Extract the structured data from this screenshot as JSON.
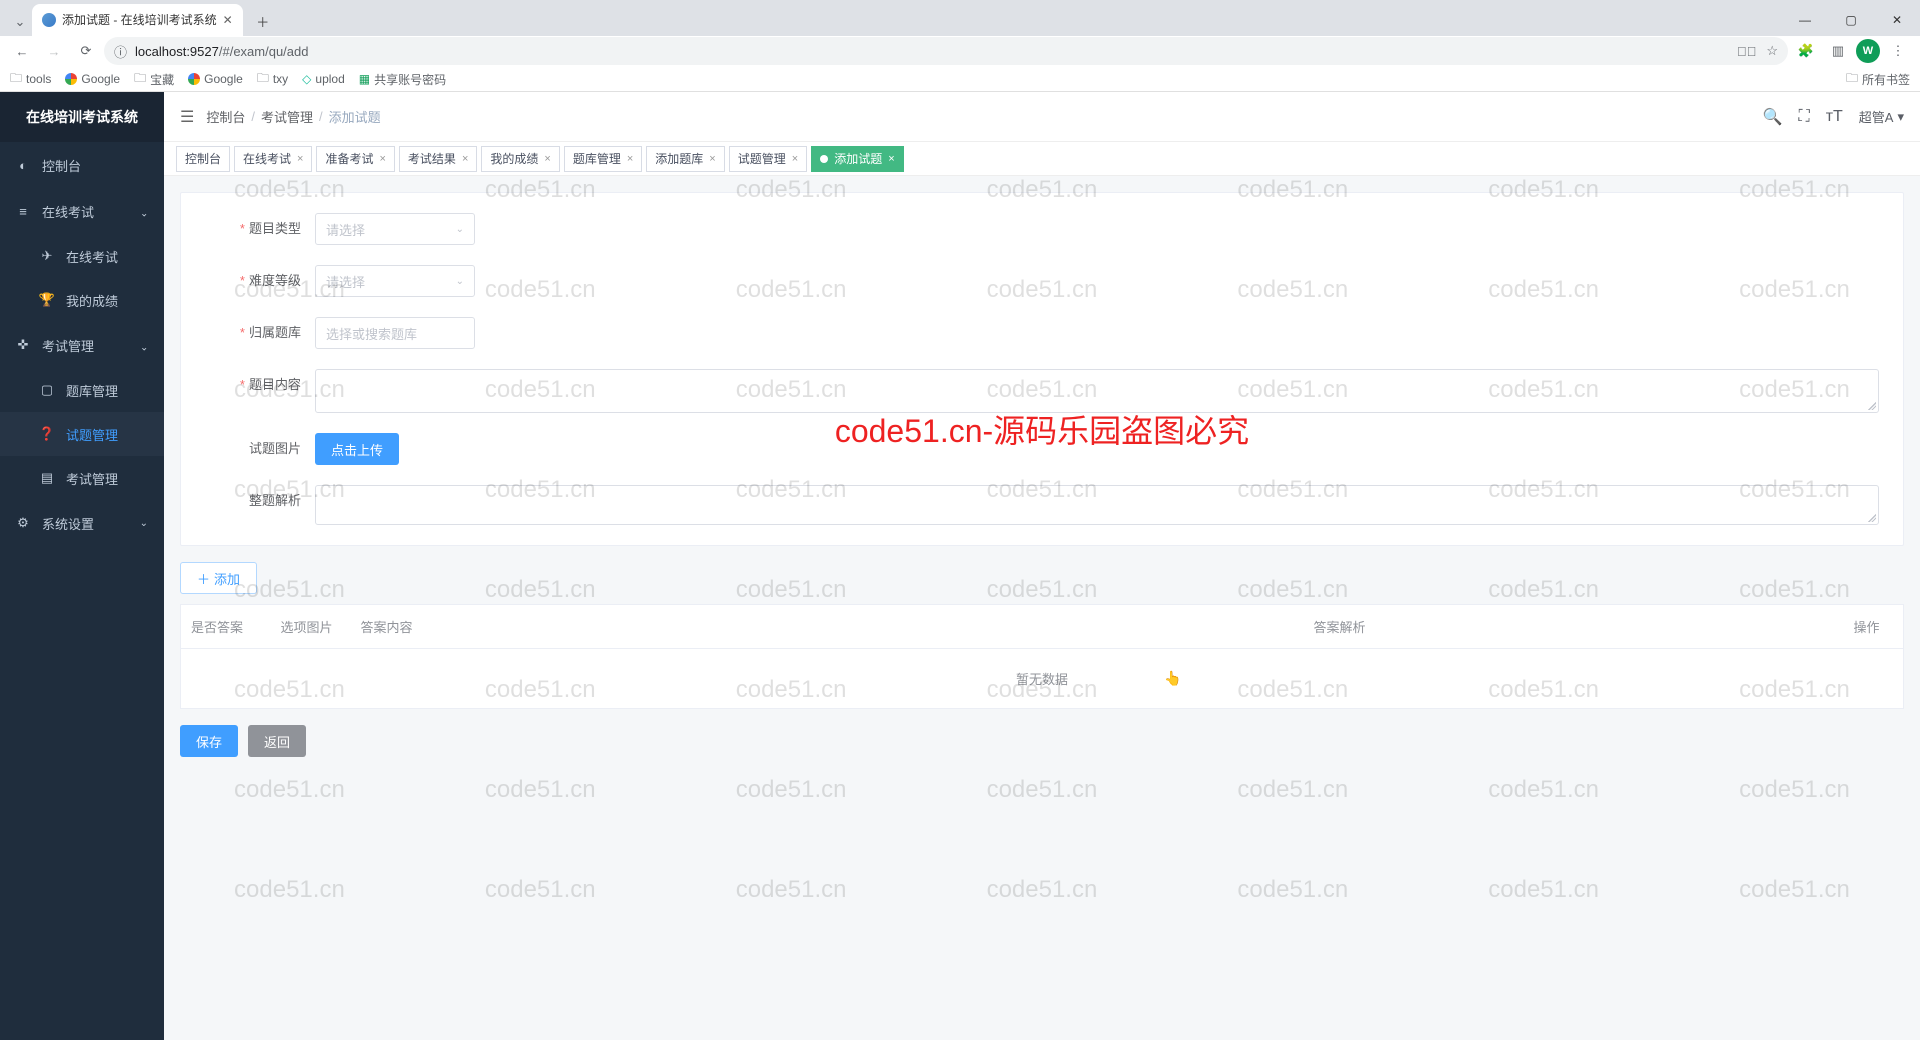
{
  "browser": {
    "tab_title": "添加试题 - 在线培训考试系统",
    "url_host": "localhost:9527",
    "url_path": "/#/exam/qu/add",
    "avatar_letter": "W",
    "bookmarks": [
      "tools",
      "Google",
      "宝藏",
      "Google",
      "txy",
      "uplod",
      "共享账号密码"
    ],
    "all_bookmarks": "所有书签"
  },
  "app": {
    "logo": "在线培训考试系统",
    "user_name": "超管A",
    "breadcrumb": [
      "控制台",
      "考试管理",
      "添加试题"
    ]
  },
  "sidebar": {
    "items": [
      {
        "icon": "◐",
        "label": "控制台",
        "type": "item"
      },
      {
        "icon": "≡",
        "label": "在线考试",
        "type": "group",
        "open": true
      },
      {
        "icon": "✈",
        "label": "在线考试",
        "type": "sub"
      },
      {
        "icon": "🏆",
        "label": "我的成绩",
        "type": "sub"
      },
      {
        "icon": "✜",
        "label": "考试管理",
        "type": "group",
        "open": true
      },
      {
        "icon": "▢",
        "label": "题库管理",
        "type": "sub"
      },
      {
        "icon": "❓",
        "label": "试题管理",
        "type": "sub",
        "active": true
      },
      {
        "icon": "▤",
        "label": "考试管理",
        "type": "sub"
      },
      {
        "icon": "⚙",
        "label": "系统设置",
        "type": "group"
      }
    ]
  },
  "tags": [
    {
      "label": "控制台",
      "closable": false
    },
    {
      "label": "在线考试",
      "closable": true
    },
    {
      "label": "准备考试",
      "closable": true
    },
    {
      "label": "考试结果",
      "closable": true
    },
    {
      "label": "我的成绩",
      "closable": true
    },
    {
      "label": "题库管理",
      "closable": true
    },
    {
      "label": "添加题库",
      "closable": true
    },
    {
      "label": "试题管理",
      "closable": true
    },
    {
      "label": "添加试题",
      "closable": true,
      "active": true
    }
  ],
  "form": {
    "type_label": "题目类型",
    "type_placeholder": "请选择",
    "level_label": "难度等级",
    "level_placeholder": "请选择",
    "repo_label": "归属题库",
    "repo_placeholder": "选择或搜索题库",
    "content_label": "题目内容",
    "image_label": "试题图片",
    "upload_btn": "点击上传",
    "analysis_label": "整题解析"
  },
  "options": {
    "add_btn": "添加",
    "columns": [
      "是否答案",
      "选项图片",
      "答案内容",
      "答案解析",
      "操作"
    ],
    "empty": "暂无数据"
  },
  "actions": {
    "save": "保存",
    "back": "返回"
  },
  "watermark": {
    "text": "code51.cn",
    "big": "code51.cn-源码乐园盗图必究"
  }
}
